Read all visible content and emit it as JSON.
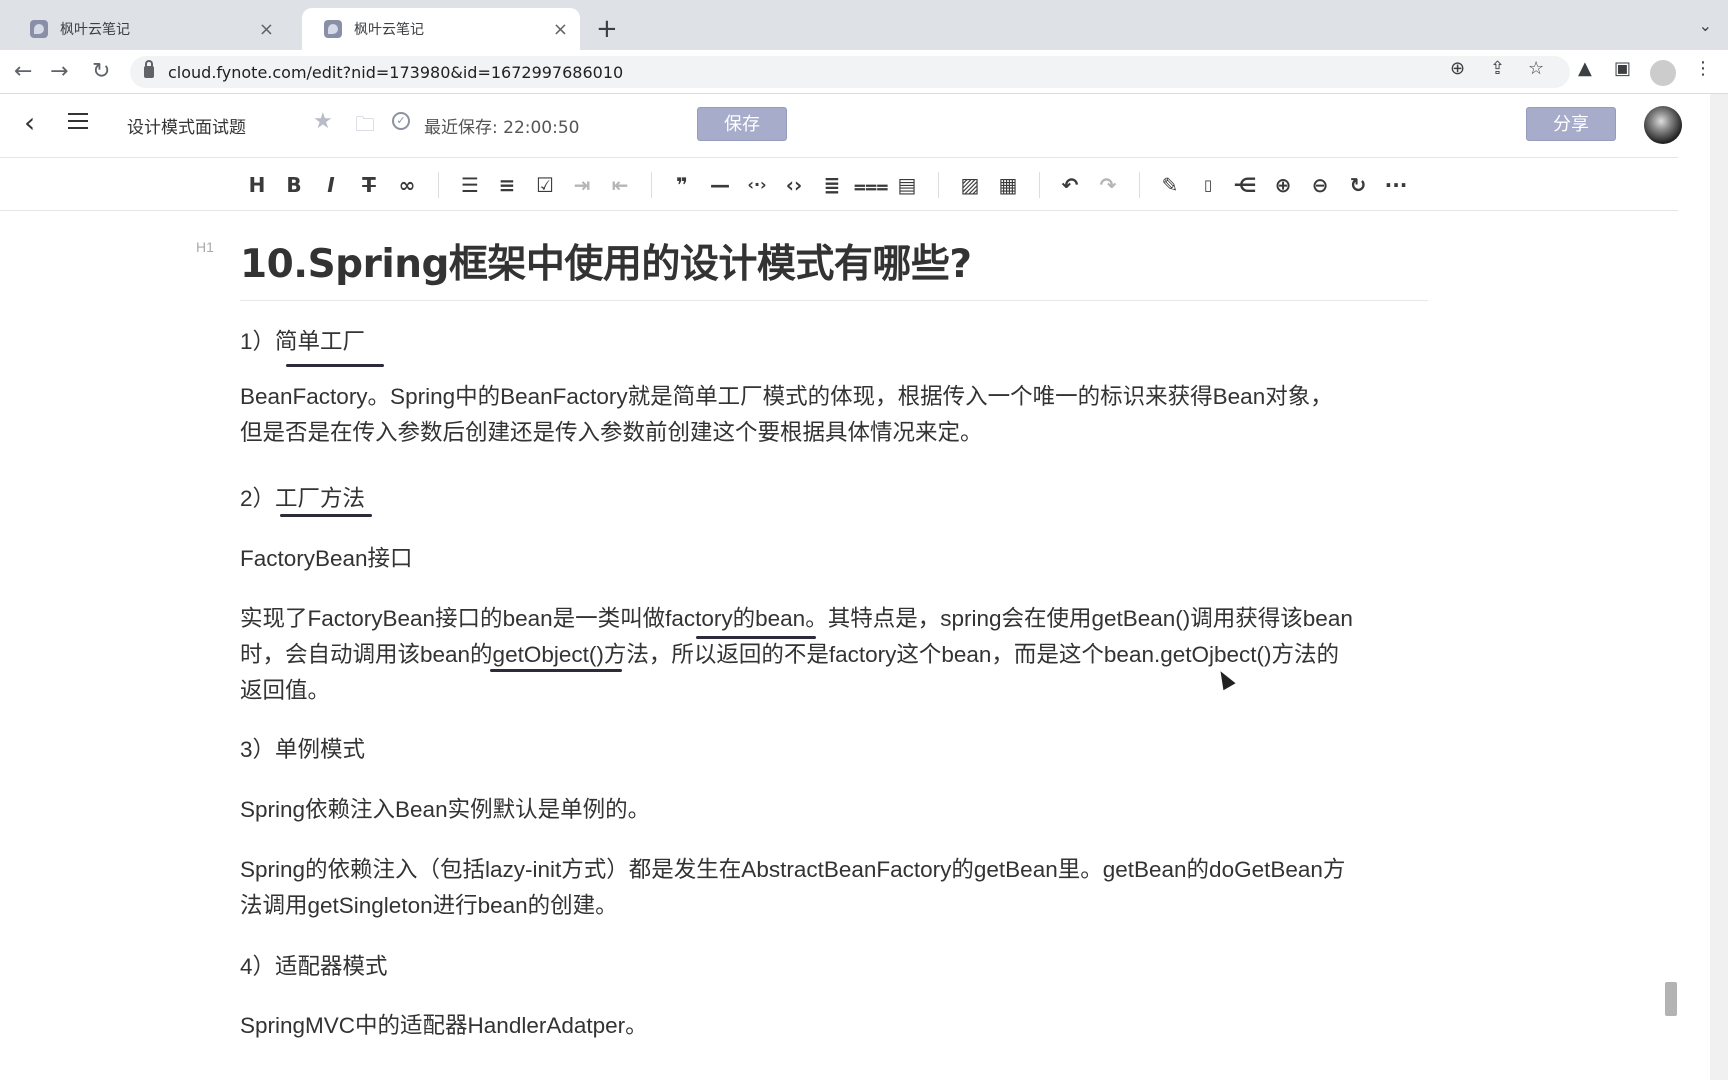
{
  "browser": {
    "tabs": [
      {
        "title": "枫叶云笔记",
        "close": "×"
      },
      {
        "title": "枫叶云笔记",
        "close": "×"
      }
    ],
    "new_tab": "+",
    "tab_menu": "⌄",
    "url": "cloud.fynote.com/edit?nid=173980&id=1672997686010"
  },
  "header": {
    "back": "‹",
    "doc_title": "设计模式面试题",
    "save_status": "最近保存: 22:00:50",
    "save_label": "保存",
    "share_label": "分享"
  },
  "toolbar": {
    "icons": [
      "heading-icon",
      "bold-icon",
      "italic-icon",
      "strikethrough-icon",
      "link-icon",
      "bullet-list-icon",
      "ordered-list-icon",
      "checkbox-icon",
      "indent-icon",
      "outdent-icon",
      "quote-icon",
      "hr-icon",
      "inline-code-icon",
      "code-block-icon",
      "align-icon",
      "format-icon",
      "export-icon",
      "image-icon",
      "table-icon",
      "undo-icon",
      "redo-icon",
      "pen-icon",
      "ppt-icon",
      "mindmap-icon",
      "zoom-in-icon",
      "zoom-out-icon",
      "refresh-icon",
      "more-icon"
    ]
  },
  "document": {
    "h1_tag": "H1",
    "title": "10.Spring框架中使用的设计模式有哪些?",
    "paragraphs": [
      "1）简单工厂",
      "BeanFactory。Spring中的BeanFactory就是简单工厂模式的体现，根据传入一个唯一的标识来获得Bean对象，",
      "但是否是在传入参数后创建还是传入参数前创建这个要根据具体情况来定。",
      "2）工厂方法",
      "FactoryBean接口",
      "实现了FactoryBean接口的bean是一类叫做factory的bean。其特点是，spring会在使用getBean()调用获得该bean",
      "时，会自动调用该bean的getObject()方法，所以返回的不是factory这个bean，而是这个bean.getOjbect()方法的",
      "返回值。",
      "3）单例模式",
      "Spring依赖注入Bean实例默认是单例的。",
      "Spring的依赖注入（包括lazy-init方式）都是发生在AbstractBeanFactory的getBean里。getBean的doGetBean方",
      "法调用getSingleton进行bean的创建。",
      "4）适配器模式",
      "SpringMVC中的适配器HandlerAdatper。"
    ]
  }
}
